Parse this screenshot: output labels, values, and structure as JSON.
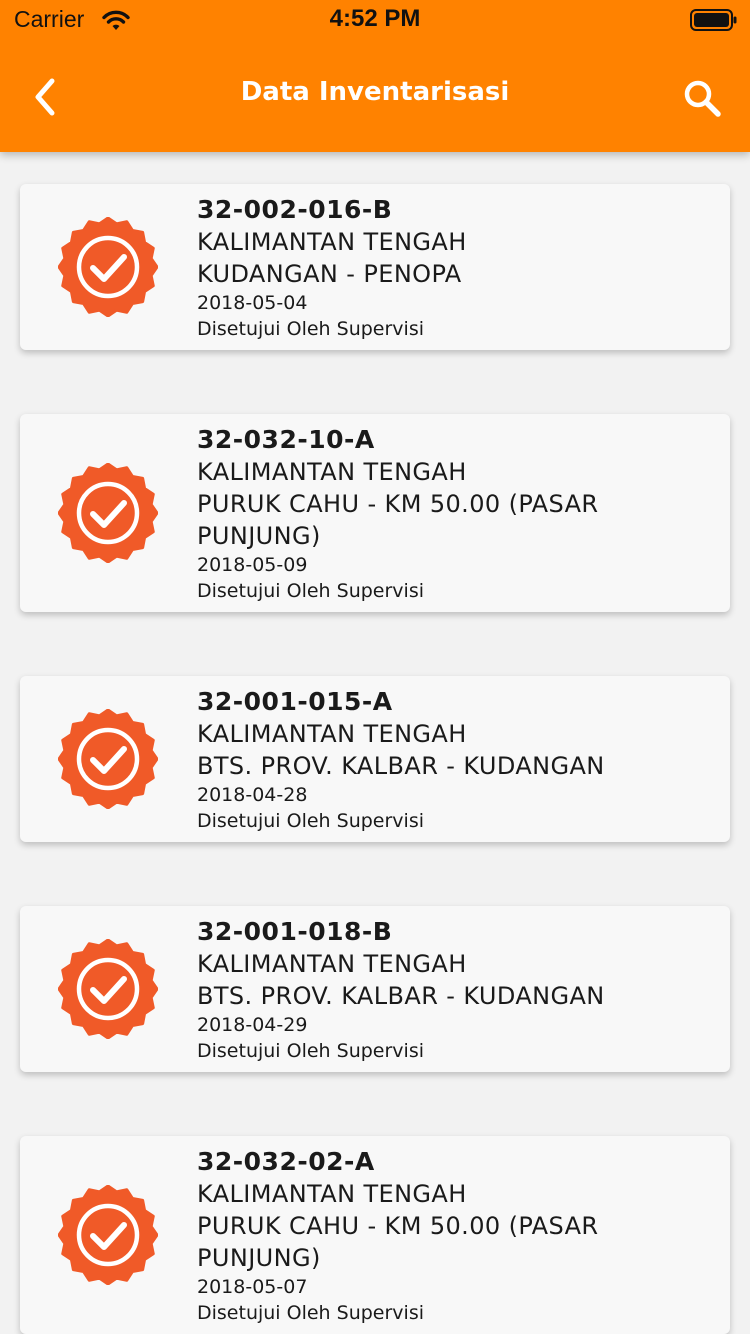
{
  "status_bar": {
    "carrier": "Carrier",
    "time": "4:52 PM"
  },
  "header": {
    "title": "Data Inventarisasi",
    "back_icon": "chevron-left-icon",
    "search_icon": "search-icon"
  },
  "colors": {
    "accent": "#ff8200",
    "badge": "#f05a28"
  },
  "items": [
    {
      "code": "32-002-016-B",
      "province": "KALIMANTAN  TENGAH",
      "route": [
        "KUDANGAN - PENOPA"
      ],
      "date": "2018-05-04",
      "status": "Disetujui Oleh Supervisi"
    },
    {
      "code": "32-032-10-A",
      "province": "KALIMANTAN  TENGAH",
      "route": [
        "PURUK CAHU - KM 50.00 (PASAR",
        "PUNJUNG)"
      ],
      "date": "2018-05-09",
      "status": "Disetujui Oleh Supervisi"
    },
    {
      "code": "32-001-015-A",
      "province": "KALIMANTAN  TENGAH",
      "route": [
        "BTS. PROV. KALBAR - KUDANGAN"
      ],
      "date": "2018-04-28",
      "status": "Disetujui Oleh Supervisi"
    },
    {
      "code": "32-001-018-B",
      "province": "KALIMANTAN  TENGAH",
      "route": [
        "BTS. PROV. KALBAR - KUDANGAN"
      ],
      "date": "2018-04-29",
      "status": "Disetujui Oleh Supervisi"
    },
    {
      "code": "32-032-02-A",
      "province": "KALIMANTAN  TENGAH",
      "route": [
        "PURUK CAHU - KM 50.00 (PASAR",
        "PUNJUNG)"
      ],
      "date": "2018-05-07",
      "status": "Disetujui Oleh Supervisi"
    }
  ]
}
